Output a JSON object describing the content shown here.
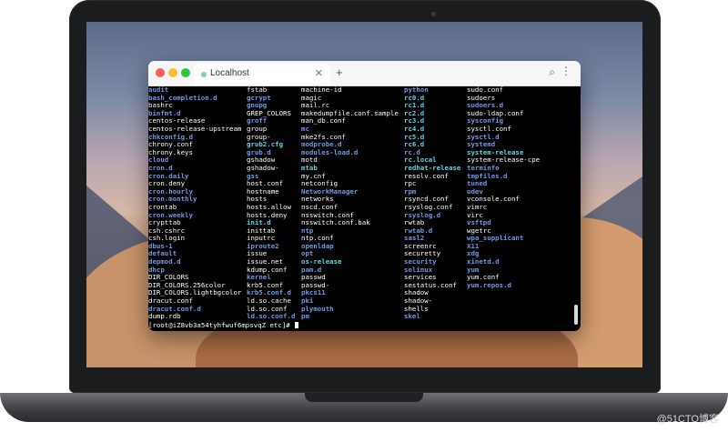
{
  "browser": {
    "tab_title": "Localhost",
    "tab_close_icon": "close-icon",
    "new_tab_icon": "plus-icon",
    "search_icon": "search-icon",
    "menu_icon": "more-vertical-icon"
  },
  "terminal": {
    "columns": [
      [
        {
          "text": "audit",
          "type": "dir"
        },
        {
          "text": "bash_completion.d",
          "type": "dir"
        },
        {
          "text": "bashrc",
          "type": "file"
        },
        {
          "text": "binfmt.d",
          "type": "dir"
        },
        {
          "text": "centos-release",
          "type": "file"
        },
        {
          "text": "centos-release-upstream",
          "type": "file"
        },
        {
          "text": "chkconfig.d",
          "type": "dir"
        },
        {
          "text": "chrony.conf",
          "type": "file"
        },
        {
          "text": "chrony.keys",
          "type": "file"
        },
        {
          "text": "cloud",
          "type": "dir"
        },
        {
          "text": "cron.d",
          "type": "dir"
        },
        {
          "text": "cron.daily",
          "type": "dir"
        },
        {
          "text": "cron.deny",
          "type": "file"
        },
        {
          "text": "cron.hourly",
          "type": "dir"
        },
        {
          "text": "cron.monthly",
          "type": "dir"
        },
        {
          "text": "crontab",
          "type": "file"
        },
        {
          "text": "cron.weekly",
          "type": "dir"
        },
        {
          "text": "crypttab",
          "type": "file"
        },
        {
          "text": "csh.cshrc",
          "type": "file"
        },
        {
          "text": "csh.login",
          "type": "file"
        },
        {
          "text": "dbus-1",
          "type": "dir"
        },
        {
          "text": "default",
          "type": "dir"
        },
        {
          "text": "depmod.d",
          "type": "dir"
        },
        {
          "text": "dhcp",
          "type": "dir"
        },
        {
          "text": "DIR_COLORS",
          "type": "file"
        },
        {
          "text": "DIR_COLORS.256color",
          "type": "file"
        },
        {
          "text": "DIR_COLORS.lightbgcolor",
          "type": "file"
        },
        {
          "text": "dracut.conf",
          "type": "file"
        },
        {
          "text": "dracut.conf.d",
          "type": "dir"
        },
        {
          "text": "dump.rdb",
          "type": "file"
        }
      ],
      [
        {
          "text": "fstab",
          "type": "file"
        },
        {
          "text": "gcrypt",
          "type": "dir"
        },
        {
          "text": "gnupg",
          "type": "dir"
        },
        {
          "text": "GREP_COLORS",
          "type": "file"
        },
        {
          "text": "groff",
          "type": "dir"
        },
        {
          "text": "group",
          "type": "file"
        },
        {
          "text": "group-",
          "type": "file"
        },
        {
          "text": "grub2.cfg",
          "type": "link"
        },
        {
          "text": "grub.d",
          "type": "dir"
        },
        {
          "text": "gshadow",
          "type": "file"
        },
        {
          "text": "gshadow-",
          "type": "file"
        },
        {
          "text": "gss",
          "type": "dir"
        },
        {
          "text": "host.conf",
          "type": "file"
        },
        {
          "text": "hostname",
          "type": "file"
        },
        {
          "text": "hosts",
          "type": "file"
        },
        {
          "text": "hosts.allow",
          "type": "file"
        },
        {
          "text": "hosts.deny",
          "type": "file"
        },
        {
          "text": "init.d",
          "type": "link"
        },
        {
          "text": "inittab",
          "type": "file"
        },
        {
          "text": "inputrc",
          "type": "file"
        },
        {
          "text": "iproute2",
          "type": "dir"
        },
        {
          "text": "issue",
          "type": "file"
        },
        {
          "text": "issue.net",
          "type": "file"
        },
        {
          "text": "kdump.conf",
          "type": "file"
        },
        {
          "text": "kernel",
          "type": "dir"
        },
        {
          "text": "krb5.conf",
          "type": "file"
        },
        {
          "text": "krb5.conf.d",
          "type": "dir"
        },
        {
          "text": "ld.so.cache",
          "type": "file"
        },
        {
          "text": "ld.so.conf",
          "type": "file"
        },
        {
          "text": "ld.so.conf.d",
          "type": "dir"
        }
      ],
      [
        {
          "text": "machine-id",
          "type": "file"
        },
        {
          "text": "magic",
          "type": "file"
        },
        {
          "text": "mail.rc",
          "type": "file"
        },
        {
          "text": "makedumpfile.conf.sample",
          "type": "file"
        },
        {
          "text": "man_db.conf",
          "type": "file"
        },
        {
          "text": "mc",
          "type": "dir"
        },
        {
          "text": "mke2fs.conf",
          "type": "file"
        },
        {
          "text": "modprobe.d",
          "type": "dir"
        },
        {
          "text": "modules-load.d",
          "type": "dir"
        },
        {
          "text": "motd",
          "type": "file"
        },
        {
          "text": "mtab",
          "type": "link"
        },
        {
          "text": "my.cnf",
          "type": "file"
        },
        {
          "text": "netconfig",
          "type": "file"
        },
        {
          "text": "NetworkManager",
          "type": "dir"
        },
        {
          "text": "networks",
          "type": "file"
        },
        {
          "text": "nscd.conf",
          "type": "file"
        },
        {
          "text": "nsswitch.conf",
          "type": "file"
        },
        {
          "text": "nsswitch.conf.bak",
          "type": "file"
        },
        {
          "text": "ntp",
          "type": "dir"
        },
        {
          "text": "ntp.conf",
          "type": "file"
        },
        {
          "text": "openldap",
          "type": "dir"
        },
        {
          "text": "opt",
          "type": "dir"
        },
        {
          "text": "os-release",
          "type": "link"
        },
        {
          "text": "pam.d",
          "type": "dir"
        },
        {
          "text": "passwd",
          "type": "file"
        },
        {
          "text": "passwd-",
          "type": "file"
        },
        {
          "text": "pkcs11",
          "type": "dir"
        },
        {
          "text": "pki",
          "type": "dir"
        },
        {
          "text": "plymouth",
          "type": "dir"
        },
        {
          "text": "pm",
          "type": "dir"
        }
      ],
      [
        {
          "text": "python",
          "type": "dir"
        },
        {
          "text": "rc0.d",
          "type": "link"
        },
        {
          "text": "rc1.d",
          "type": "link"
        },
        {
          "text": "rc2.d",
          "type": "link"
        },
        {
          "text": "rc3.d",
          "type": "link"
        },
        {
          "text": "rc4.d",
          "type": "link"
        },
        {
          "text": "rc5.d",
          "type": "link"
        },
        {
          "text": "rc6.d",
          "type": "link"
        },
        {
          "text": "rc.d",
          "type": "dir"
        },
        {
          "text": "rc.local",
          "type": "link"
        },
        {
          "text": "redhat-release",
          "type": "link"
        },
        {
          "text": "resolv.conf",
          "type": "file"
        },
        {
          "text": "rpc",
          "type": "file"
        },
        {
          "text": "rpm",
          "type": "dir"
        },
        {
          "text": "rsyncd.conf",
          "type": "file"
        },
        {
          "text": "rsyslog.conf",
          "type": "file"
        },
        {
          "text": "rsyslog.d",
          "type": "dir"
        },
        {
          "text": "rwtab",
          "type": "file"
        },
        {
          "text": "rwtab.d",
          "type": "dir"
        },
        {
          "text": "sasl2",
          "type": "dir"
        },
        {
          "text": "screenrc",
          "type": "file"
        },
        {
          "text": "securetty",
          "type": "file"
        },
        {
          "text": "security",
          "type": "dir"
        },
        {
          "text": "selinux",
          "type": "dir"
        },
        {
          "text": "services",
          "type": "file"
        },
        {
          "text": "sestatus.conf",
          "type": "file"
        },
        {
          "text": "shadow",
          "type": "file"
        },
        {
          "text": "shadow-",
          "type": "file"
        },
        {
          "text": "shells",
          "type": "file"
        },
        {
          "text": "skel",
          "type": "dir"
        }
      ],
      [
        {
          "text": "sudo.conf",
          "type": "file"
        },
        {
          "text": "sudoers",
          "type": "file"
        },
        {
          "text": "sudoers.d",
          "type": "dir"
        },
        {
          "text": "sudo-ldap.conf",
          "type": "file"
        },
        {
          "text": "sysconfig",
          "type": "dir"
        },
        {
          "text": "sysctl.conf",
          "type": "file"
        },
        {
          "text": "sysctl.d",
          "type": "dir"
        },
        {
          "text": "systemd",
          "type": "dir"
        },
        {
          "text": "system-release",
          "type": "link"
        },
        {
          "text": "system-release-cpe",
          "type": "file"
        },
        {
          "text": "terminfo",
          "type": "dir"
        },
        {
          "text": "tmpfiles.d",
          "type": "dir"
        },
        {
          "text": "tuned",
          "type": "dir"
        },
        {
          "text": "udev",
          "type": "dir"
        },
        {
          "text": "vconsole.conf",
          "type": "file"
        },
        {
          "text": "vimrc",
          "type": "file"
        },
        {
          "text": "virc",
          "type": "file"
        },
        {
          "text": "vsftpd",
          "type": "dir"
        },
        {
          "text": "wgetrc",
          "type": "file"
        },
        {
          "text": "wpa_supplicant",
          "type": "dir"
        },
        {
          "text": "X11",
          "type": "dir"
        },
        {
          "text": "xdg",
          "type": "dir"
        },
        {
          "text": "xinetd.d",
          "type": "dir"
        },
        {
          "text": "yum",
          "type": "dir"
        },
        {
          "text": "yum.conf",
          "type": "file"
        },
        {
          "text": "yum.repos.d",
          "type": "dir"
        }
      ]
    ],
    "prompt": "[root@iZ8vb3a54tyhfwuf6mpsvqZ etc]# "
  },
  "colors": {
    "file": "#ffffff",
    "dir": "#6f9be6",
    "link": "#5fd7e6",
    "terminal_bg": "#000000"
  },
  "watermark": "@51CTO博客"
}
